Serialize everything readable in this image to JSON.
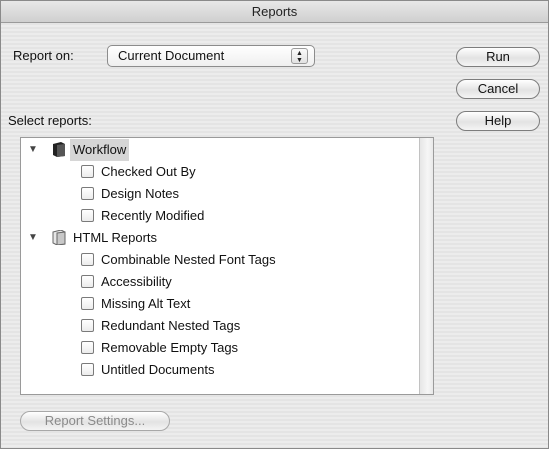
{
  "window": {
    "title": "Reports"
  },
  "report_on": {
    "label": "Report on:",
    "selected": "Current Document"
  },
  "select_reports_label": "Select reports:",
  "buttons": {
    "run": "Run",
    "cancel": "Cancel",
    "help": "Help",
    "report_settings": "Report Settings..."
  },
  "tree": {
    "groups": [
      {
        "label": "Workflow",
        "icon": "folder-dark-icon",
        "items": [
          "Checked Out By",
          "Design Notes",
          "Recently Modified"
        ]
      },
      {
        "label": "HTML Reports",
        "icon": "folder-light-icon",
        "items": [
          "Combinable Nested Font Tags",
          "Accessibility",
          "Missing Alt Text",
          "Redundant Nested Tags",
          "Removable Empty Tags",
          "Untitled Documents"
        ]
      }
    ]
  }
}
